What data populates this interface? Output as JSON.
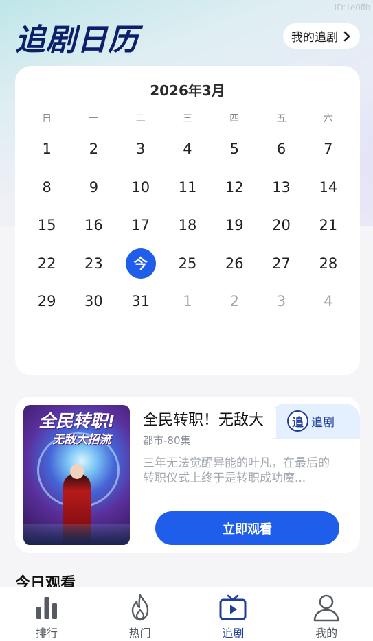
{
  "watermark": "ID:1e0ffb",
  "header": {
    "title": "追剧日历",
    "my_follow_label": "我的追剧"
  },
  "calendar": {
    "month_label": "2026年3月",
    "weekdays": [
      "日",
      "一",
      "二",
      "三",
      "四",
      "五",
      "六"
    ],
    "today_label": "今",
    "weeks": [
      [
        "1",
        "2",
        "3",
        "4",
        "5",
        "6",
        "7"
      ],
      [
        "8",
        "9",
        "10",
        "11",
        "12",
        "13",
        "14"
      ],
      [
        "15",
        "16",
        "17",
        "18",
        "19",
        "20",
        "21"
      ],
      [
        "22",
        "23",
        "今",
        "25",
        "26",
        "27",
        "28"
      ],
      [
        "29",
        "30",
        "31",
        "1",
        "2",
        "3",
        "4"
      ]
    ]
  },
  "drama": {
    "poster_title": "全民转职!",
    "poster_subtitle": "无敌大招流",
    "title": "全民转职！无敌大",
    "follow_badge": "追",
    "follow_label": "追剧",
    "meta": "都市-80集",
    "description": "三年无法觉醒异能的叶凡，在最后的转职仪式上终于是转职成功魔...",
    "watch_label": "立即观看"
  },
  "today_section": {
    "title": "今日观看"
  },
  "tabbar": {
    "items": [
      {
        "label": "排行",
        "icon": "bar-chart-icon"
      },
      {
        "label": "热门",
        "icon": "flame-icon"
      },
      {
        "label": "追剧",
        "icon": "tv-icon"
      },
      {
        "label": "我的",
        "icon": "user-icon"
      }
    ],
    "active_index": 2
  },
  "colors": {
    "accent": "#1f5eea",
    "title": "#0d1f6b",
    "active_tab": "#1f3e9a"
  }
}
